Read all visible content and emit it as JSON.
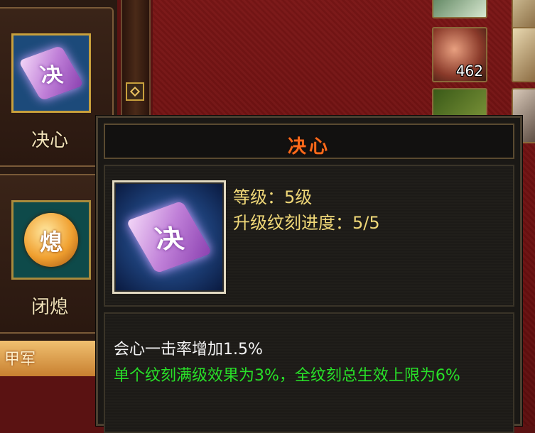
{
  "skills": [
    {
      "label": "决心",
      "icon": "determination-gem-icon",
      "glyph": "决"
    },
    {
      "label": "闭熄",
      "icon": "breath-coin-icon",
      "glyph": "熄"
    }
  ],
  "banner": {
    "text": "甲军"
  },
  "bag": {
    "meat_count": "462"
  },
  "tooltip": {
    "title": "决心",
    "icon_glyph": "决",
    "level": "等级：5级",
    "progress": "升级纹刻进度：5/5",
    "effect": "会心一击率增加1.5%",
    "bonus": "单个纹刻满级效果为3%，全纹刻总生效上限为6%"
  },
  "colors": {
    "title": "#ff6a1a",
    "stats": "#f0d878",
    "bonus": "#28e028",
    "frame_gold": "#c8a03c"
  }
}
